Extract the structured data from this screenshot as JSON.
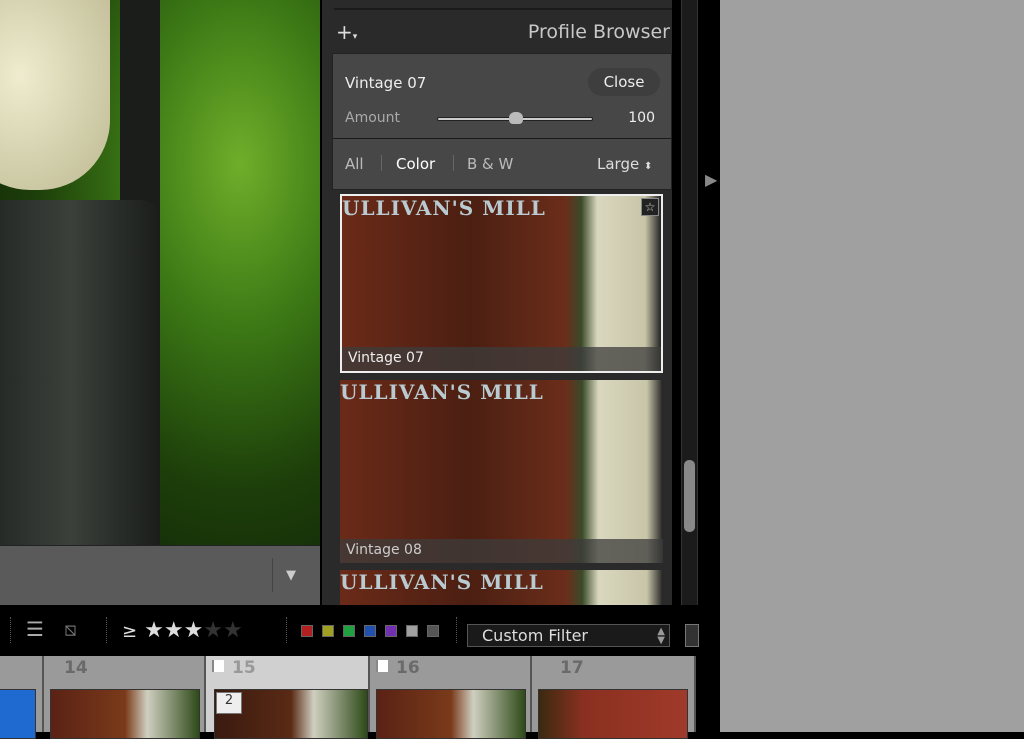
{
  "panel": {
    "title": "Profile Browser",
    "add_icon": "plus-icon",
    "selected_profile": "Vintage 07",
    "close_label": "Close",
    "amount_label": "Amount",
    "amount_value": "100",
    "amount_level": 100,
    "tabs": [
      {
        "label": "All"
      },
      {
        "label": "Color"
      },
      {
        "label": "B & W"
      }
    ],
    "active_tab": "Color",
    "size_select": "Large",
    "profiles": [
      {
        "name": "Vintage 07",
        "selected": true
      },
      {
        "name": "Vintage 08"
      },
      {
        "name": ""
      }
    ],
    "sign_text": "ULLIVAN'S MILL"
  },
  "filter_bar": {
    "rating_op": "≥",
    "rating": 3,
    "max_rating": 5,
    "color_labels": [
      "#b02020",
      "#a0a020",
      "#20a040",
      "#2050b0",
      "#7030b0",
      "#a0a0a0",
      "#555555"
    ],
    "filter_select": "Custom Filter"
  },
  "filmstrip": [
    {
      "number": "14"
    },
    {
      "number": "15",
      "flagged": true,
      "selected": true,
      "badge": "2"
    },
    {
      "number": "16",
      "flagged": true
    },
    {
      "number": "17"
    }
  ]
}
